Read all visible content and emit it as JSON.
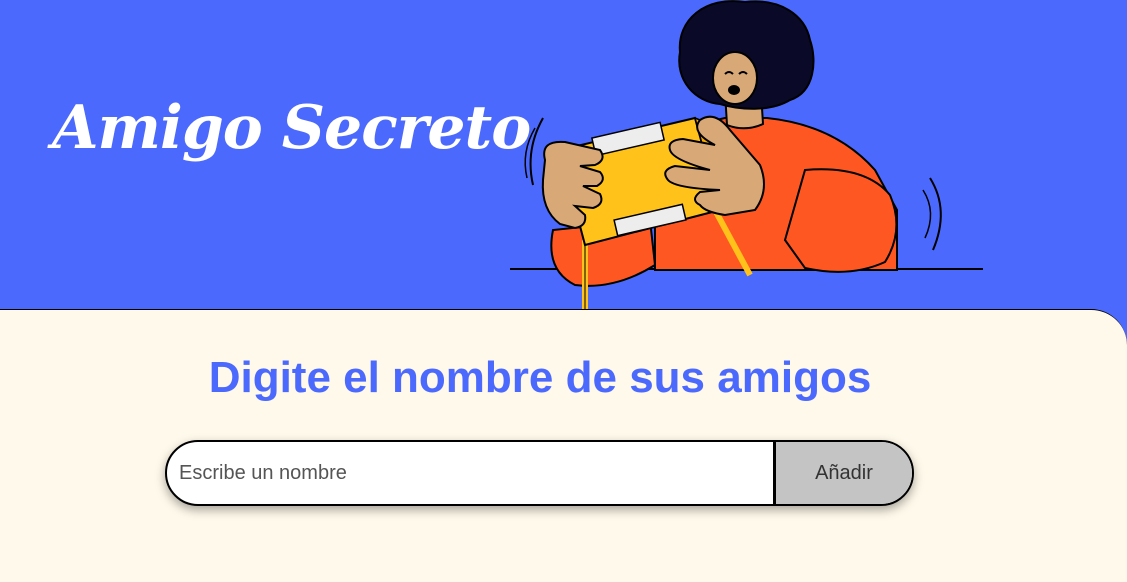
{
  "header": {
    "title": "Amigo Secreto",
    "illustration": "person-opening-gift-box"
  },
  "main": {
    "section_title": "Digite el nombre de sus amigos",
    "input": {
      "value": "",
      "placeholder": "Escribe un nombre"
    },
    "add_button_label": "Añadir"
  },
  "colors": {
    "primary": "#4B69FD",
    "background": "#FFF9EB",
    "button": "#C4C4C4",
    "shirt": "#FF5722",
    "box": "#FFC21A"
  }
}
